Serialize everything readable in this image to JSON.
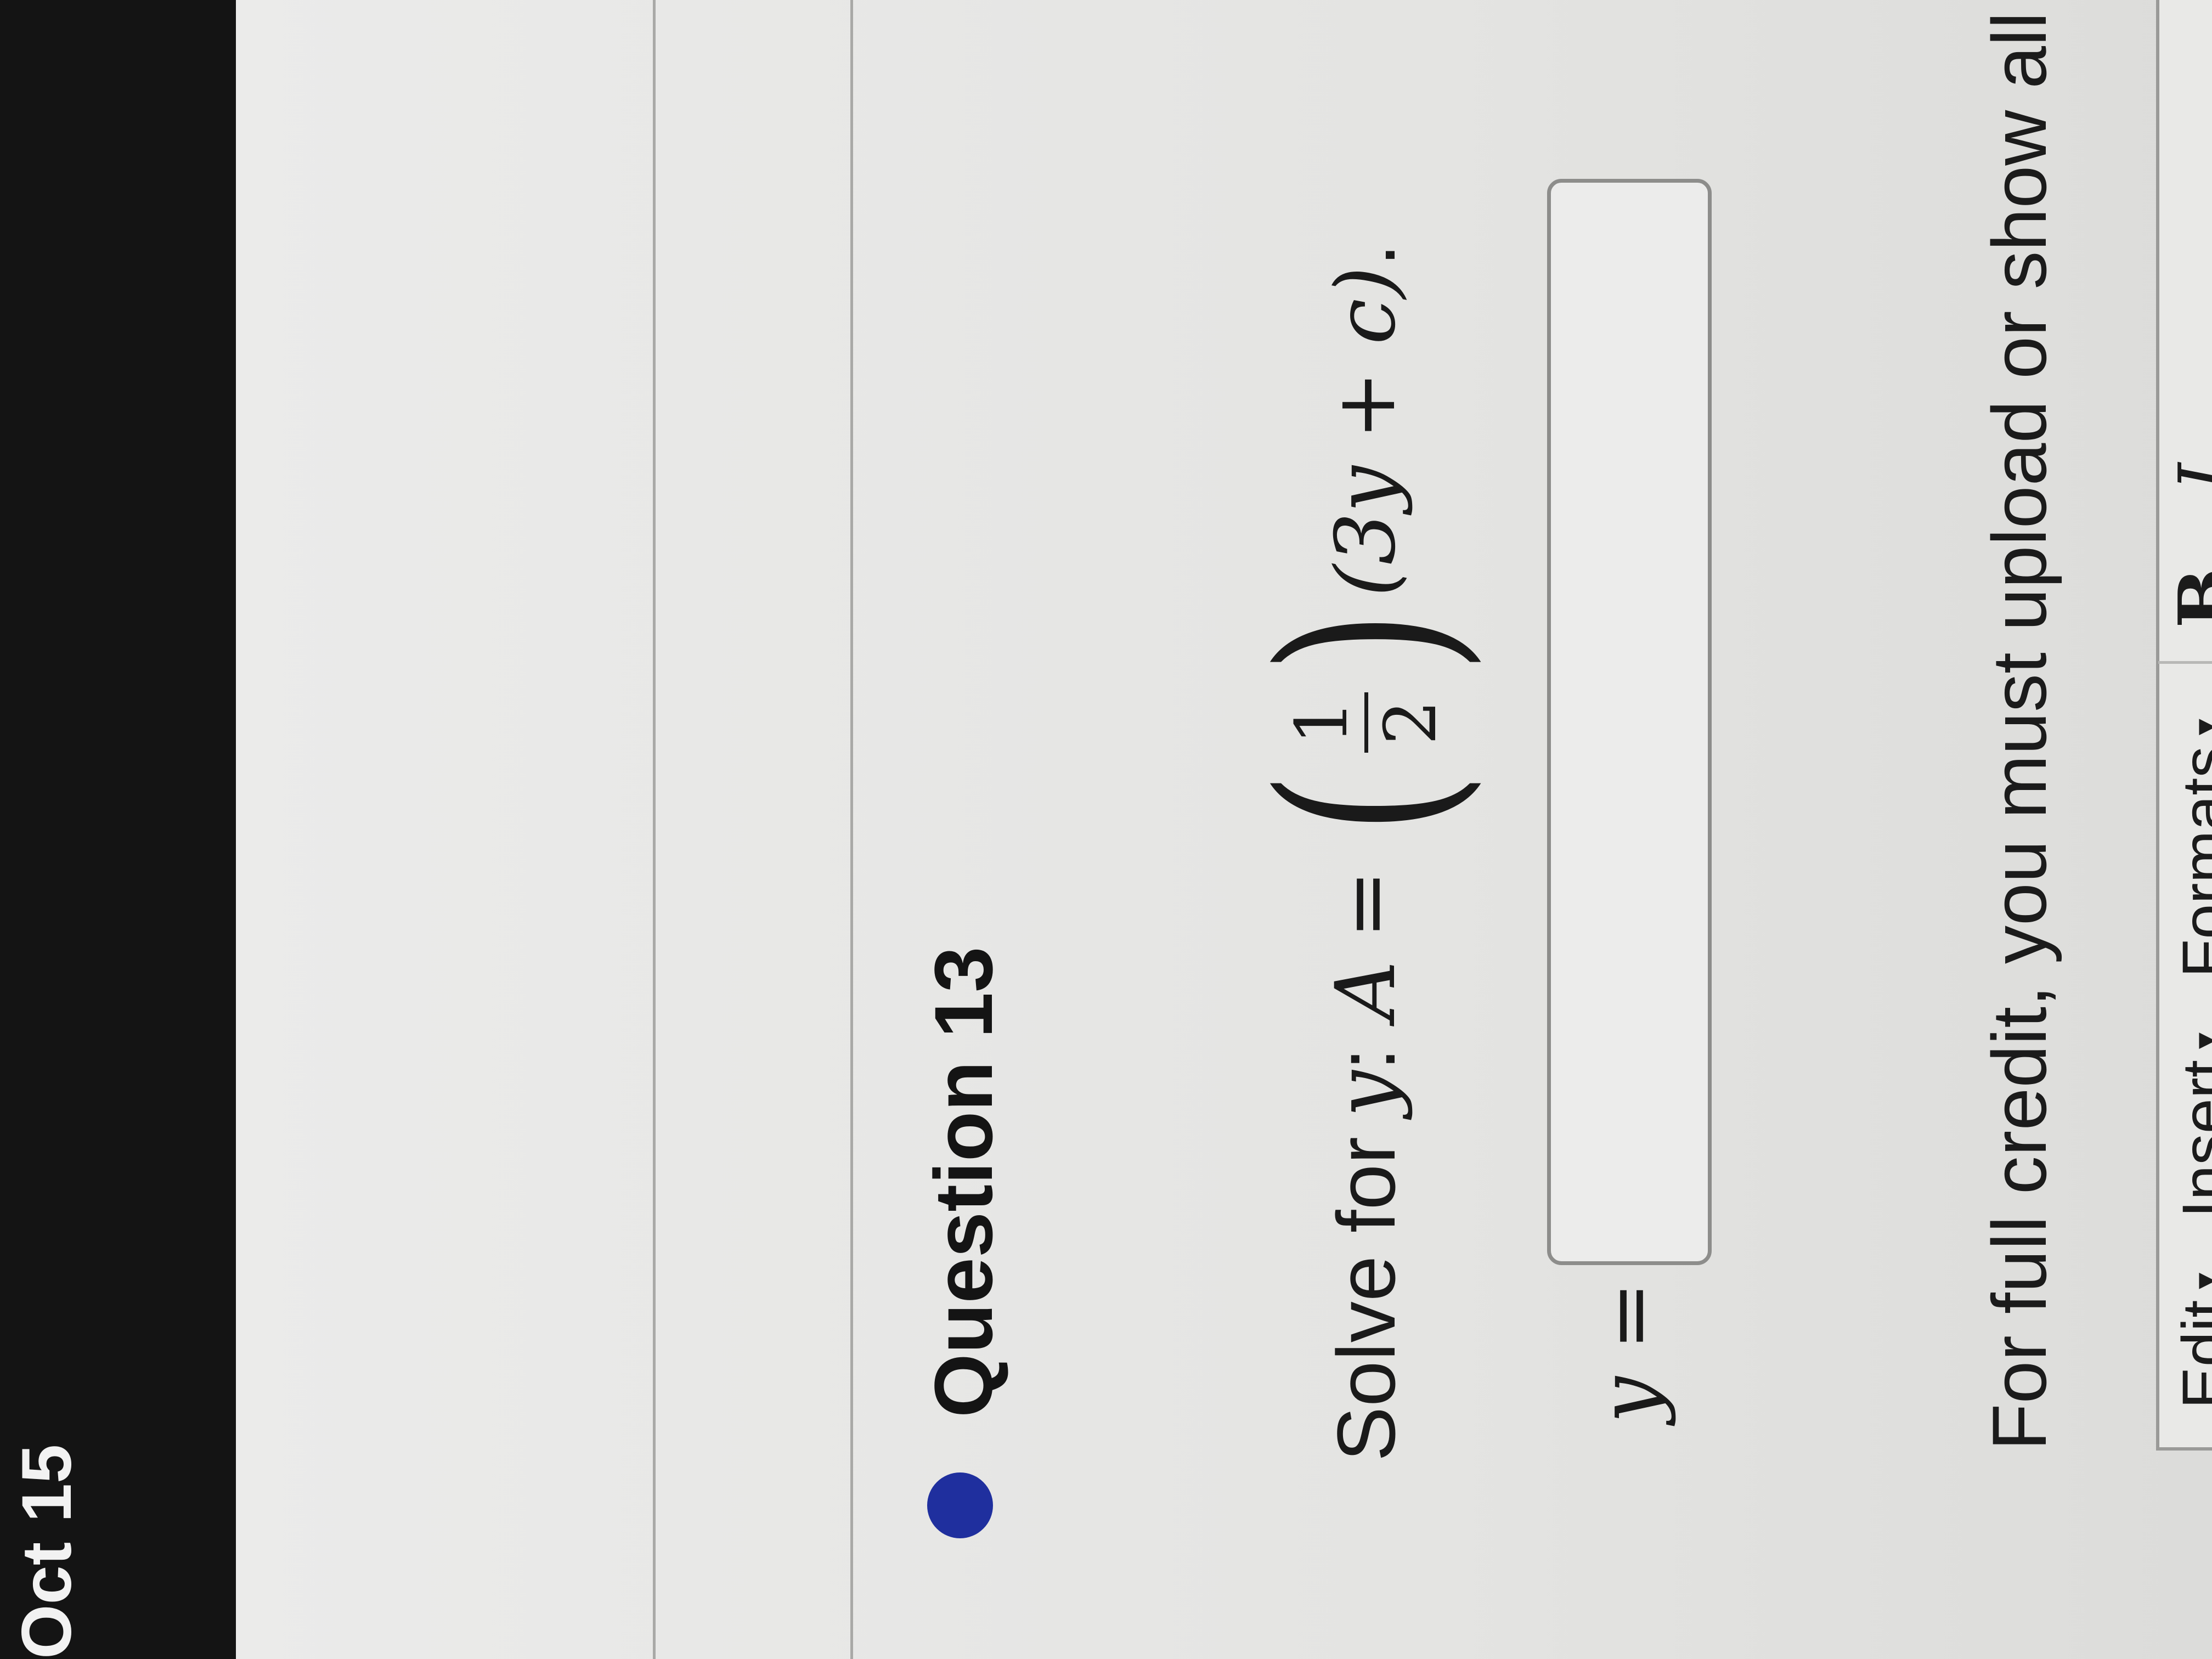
{
  "status_bar": {
    "date": "Oct 15"
  },
  "question": {
    "title": "Question 13",
    "prompt_prefix": "Solve for",
    "variable": "y",
    "colon": ":",
    "lhs": "A",
    "equals": "=",
    "frac_num": "1",
    "frac_den": "2",
    "paren_open": "(",
    "paren_close": ")",
    "expr": "(3y + c)",
    "period": "."
  },
  "answer": {
    "label": "y =",
    "value": ""
  },
  "instructions": {
    "text": "For full credit, you must upload or show all"
  },
  "editor": {
    "menus": [
      {
        "label": "Edit"
      },
      {
        "label": "Insert"
      },
      {
        "label": "Formats"
      }
    ],
    "bold_label": "B",
    "italic_label": "I",
    "caret": "▾"
  },
  "colors": {
    "status_dot": "#1f2f9e",
    "topbar": "#141414",
    "page_bg": "#e6e6e4"
  }
}
